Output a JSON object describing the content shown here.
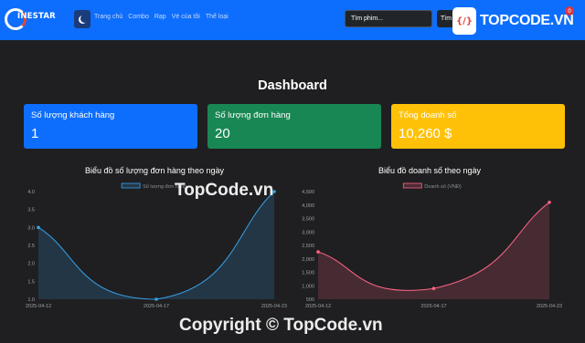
{
  "navbar": {
    "logo_text": "INESTAR",
    "links": [
      "Trang chủ",
      "Combo",
      "Rạp",
      "Vé của tôi",
      "Thể loại"
    ],
    "search_placeholder": "Tìm phim...",
    "search_button": "Tìm"
  },
  "brand_overlay": {
    "text": "TOPCODE.VN",
    "badge": "0"
  },
  "page": {
    "title": "Dashboard"
  },
  "cards": [
    {
      "label": "Số lượng khách hàng",
      "value": "1",
      "color": "#0d6efd"
    },
    {
      "label": "Số lượng đơn hàng",
      "value": "20",
      "color": "#198754"
    },
    {
      "label": "Tổng doanh số",
      "value": "10,260 $",
      "color": "#ffc107"
    }
  ],
  "chart_data": [
    {
      "type": "line",
      "title": "Biểu đồ số lượng đơn hàng theo ngày",
      "categories": [
        "2025-04-12",
        "2025-04-17",
        "2025-04-23"
      ],
      "series": [
        {
          "name": "Số lượng đơn hàng",
          "values": [
            3.0,
            1.0,
            4.0
          ],
          "color": "#36a2eb"
        }
      ],
      "ylim": [
        1.0,
        4.0
      ],
      "yticks": [
        "4.0",
        "3.5",
        "3.0",
        "2.5",
        "2.0",
        "1.5",
        "1.0"
      ],
      "legend": "top"
    },
    {
      "type": "line",
      "title": "Biểu đồ doanh số theo ngày",
      "categories": [
        "2025-04-12",
        "2025-04-17",
        "2025-04-23"
      ],
      "series": [
        {
          "name": "Doanh số (VNĐ)",
          "values": [
            2260,
            900,
            4100
          ],
          "color": "#ff6384"
        }
      ],
      "ylim": [
        500,
        4500
      ],
      "yticks": [
        "4,500",
        "4,000",
        "3,500",
        "3,000",
        "2,500",
        "2,000",
        "1,500",
        "1,000",
        "500"
      ],
      "legend": "top"
    }
  ],
  "watermarks": {
    "middle": "TopCode.vn",
    "bottom": "Copyright © TopCode.vn"
  }
}
